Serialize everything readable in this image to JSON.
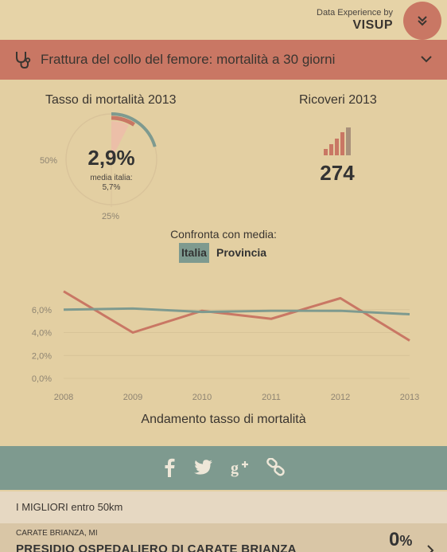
{
  "header": {
    "brand_line": "Data Experience by",
    "brand_name": "VISUP",
    "menu_icon": "double-chevron-down-icon"
  },
  "title_bar": {
    "icon": "stethoscope-icon",
    "title": "Frattura del collo del femore: mortalità a 30 giorni",
    "chevron_icon": "chevron-down-icon"
  },
  "mortality": {
    "label": "Tasso di mortalità 2013",
    "value": "2,9%",
    "avg_label": "media italia:",
    "avg_value": "5,7%",
    "tick_left": "50%",
    "tick_bottom": "25%",
    "value_fraction": 0.029,
    "avg_fraction": 0.057
  },
  "admissions": {
    "label": "Ricoveri 2013",
    "value": "274",
    "icon": "bar-chart-icon"
  },
  "compare": {
    "label": "Confronta con media:",
    "options": [
      "Italia",
      "Provincia"
    ],
    "selected": "Italia"
  },
  "chart_data": {
    "type": "line",
    "x": [
      "2008",
      "2009",
      "2010",
      "2011",
      "2012",
      "2013"
    ],
    "series": [
      {
        "values": [
          7.6,
          4.0,
          5.9,
          5.2,
          7.0,
          3.3
        ],
        "color": "#c97764"
      },
      {
        "values": [
          6.0,
          6.1,
          5.8,
          5.9,
          5.9,
          5.6
        ],
        "color": "#7e9a8f"
      }
    ],
    "yticks": [
      "0,0%",
      "2,0%",
      "4,0%",
      "6,0%"
    ],
    "ylim": [
      0,
      8
    ],
    "title": "Andamento tasso di mortalità",
    "grid": true
  },
  "social": {
    "icons": [
      "facebook-icon",
      "twitter-icon",
      "google-plus-icon",
      "link-icon"
    ]
  },
  "best": {
    "label": "I MIGLIORI entro 50km"
  },
  "hospital": {
    "city": "CARATE BRIANZA, MI",
    "name": "PRESIDIO OSPEDALIERO DI CARATE BRIANZA",
    "value": "0",
    "unit": "%"
  },
  "colors": {
    "background": "#e3cfa2",
    "accent_red": "#c97764",
    "accent_green": "#7e9a8f"
  }
}
